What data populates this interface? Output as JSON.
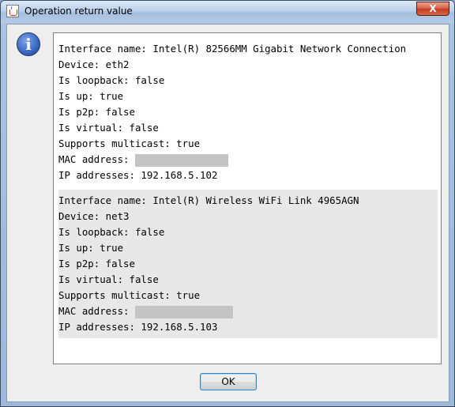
{
  "window": {
    "title": "Operation return value",
    "close_label": "X"
  },
  "dialog": {
    "info_icon_glyph": "i",
    "ok_label": "OK"
  },
  "interfaces": [
    {
      "name_line": "Interface name: Intel(R) 82566MM Gigabit Network Connection",
      "device_line": "Device: eth2",
      "loopback_line": "Is loopback: false",
      "up_line": "Is up: true",
      "p2p_line": "Is p2p: false",
      "virtual_line": "Is virtual: false",
      "multicast_line": "Supports multicast: true",
      "mac_label": "MAC address: ",
      "ip_line": "IP addresses: 192.168.5.102"
    },
    {
      "name_line": "Interface name: Intel(R) Wireless WiFi Link 4965AGN",
      "device_line": "Device: net3",
      "loopback_line": "Is loopback: false",
      "up_line": "Is up: true",
      "p2p_line": "Is p2p: false",
      "virtual_line": "Is virtual: false",
      "multicast_line": "Supports multicast: true",
      "mac_label": "MAC address: ",
      "ip_line": "IP addresses: 192.168.5.103"
    }
  ],
  "colors": {
    "redaction": "#c4c4c4",
    "alt_row": "#e8e8e8",
    "close_button": "#c13b20"
  },
  "icons": {
    "app": "java-cup-icon",
    "info": "info-icon",
    "close": "close-icon"
  }
}
